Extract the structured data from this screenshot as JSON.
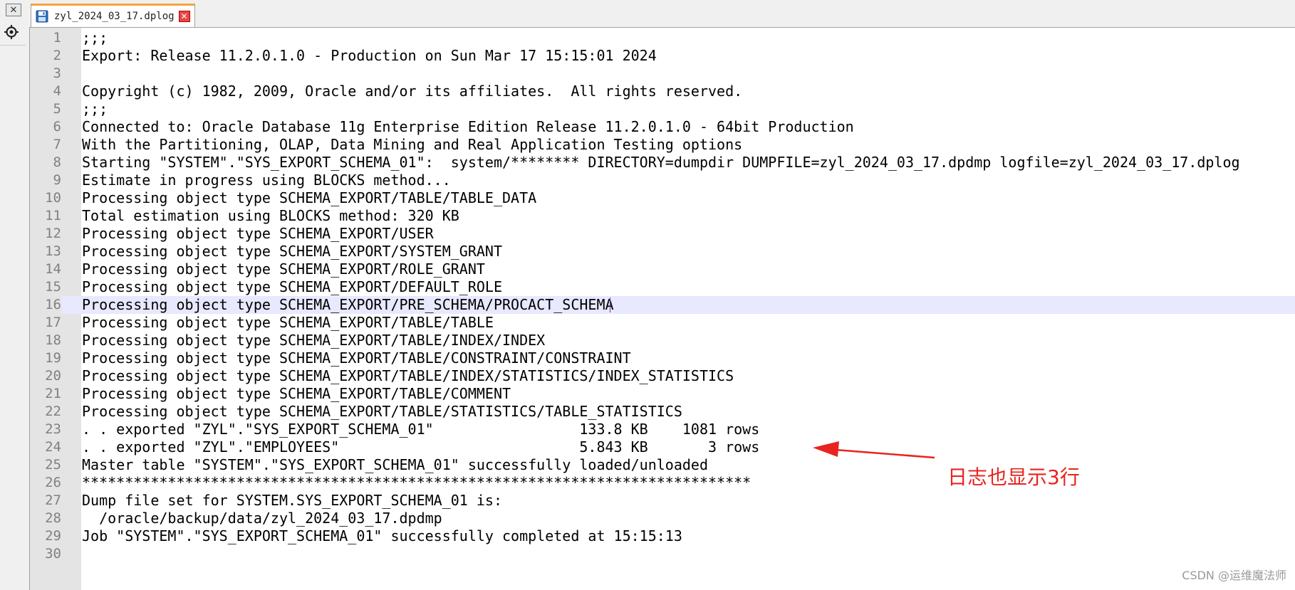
{
  "window": {
    "close_glyph": "✕"
  },
  "tab": {
    "file_icon": "save-disk-icon",
    "label": "zyl_2024_03_17.dplog",
    "close_glyph": "✕"
  },
  "toolbar": {
    "locate_icon": "target-icon"
  },
  "editor": {
    "current_line": 16,
    "lines": [
      {
        "n": "1",
        "text": ";;;"
      },
      {
        "n": "2",
        "text": "Export: Release 11.2.0.1.0 - Production on Sun Mar 17 15:15:01 2024"
      },
      {
        "n": "3",
        "text": ""
      },
      {
        "n": "4",
        "text": "Copyright (c) 1982, 2009, Oracle and/or its affiliates.  All rights reserved."
      },
      {
        "n": "5",
        "text": ";;;"
      },
      {
        "n": "6",
        "text": "Connected to: Oracle Database 11g Enterprise Edition Release 11.2.0.1.0 - 64bit Production"
      },
      {
        "n": "7",
        "text": "With the Partitioning, OLAP, Data Mining and Real Application Testing options"
      },
      {
        "n": "8",
        "text": "Starting \"SYSTEM\".\"SYS_EXPORT_SCHEMA_01\":  system/******** DIRECTORY=dumpdir DUMPFILE=zyl_2024_03_17.dpdmp logfile=zyl_2024_03_17.dplog"
      },
      {
        "n": "9",
        "text": "Estimate in progress using BLOCKS method..."
      },
      {
        "n": "10",
        "text": "Processing object type SCHEMA_EXPORT/TABLE/TABLE_DATA"
      },
      {
        "n": "11",
        "text": "Total estimation using BLOCKS method: 320 KB"
      },
      {
        "n": "12",
        "text": "Processing object type SCHEMA_EXPORT/USER"
      },
      {
        "n": "13",
        "text": "Processing object type SCHEMA_EXPORT/SYSTEM_GRANT"
      },
      {
        "n": "14",
        "text": "Processing object type SCHEMA_EXPORT/ROLE_GRANT"
      },
      {
        "n": "15",
        "text": "Processing object type SCHEMA_EXPORT/DEFAULT_ROLE"
      },
      {
        "n": "16",
        "text": "Processing object type SCHEMA_EXPORT/PRE_SCHEMA/PROCACT_SCHEMA"
      },
      {
        "n": "17",
        "text": "Processing object type SCHEMA_EXPORT/TABLE/TABLE"
      },
      {
        "n": "18",
        "text": "Processing object type SCHEMA_EXPORT/TABLE/INDEX/INDEX"
      },
      {
        "n": "19",
        "text": "Processing object type SCHEMA_EXPORT/TABLE/CONSTRAINT/CONSTRAINT"
      },
      {
        "n": "20",
        "text": "Processing object type SCHEMA_EXPORT/TABLE/INDEX/STATISTICS/INDEX_STATISTICS"
      },
      {
        "n": "21",
        "text": "Processing object type SCHEMA_EXPORT/TABLE/COMMENT"
      },
      {
        "n": "22",
        "text": "Processing object type SCHEMA_EXPORT/TABLE/STATISTICS/TABLE_STATISTICS"
      },
      {
        "n": "23",
        "text": ". . exported \"ZYL\".\"SYS_EXPORT_SCHEMA_01\"                 133.8 KB    1081 rows"
      },
      {
        "n": "24",
        "text": ". . exported \"ZYL\".\"EMPLOYEES\"                            5.843 KB       3 rows"
      },
      {
        "n": "25",
        "text": "Master table \"SYSTEM\".\"SYS_EXPORT_SCHEMA_01\" successfully loaded/unloaded"
      },
      {
        "n": "26",
        "text": "******************************************************************************"
      },
      {
        "n": "27",
        "text": "Dump file set for SYSTEM.SYS_EXPORT_SCHEMA_01 is:"
      },
      {
        "n": "28",
        "text": "  /oracle/backup/data/zyl_2024_03_17.dpdmp"
      },
      {
        "n": "29",
        "text": "Job \"SYSTEM\".\"SYS_EXPORT_SCHEMA_01\" successfully completed at 15:15:13"
      },
      {
        "n": "30",
        "text": ""
      }
    ]
  },
  "annotation": {
    "text": "日志也显示3行",
    "color": "#e8241f"
  },
  "watermark": {
    "text": "CSDN @运维魔法师"
  },
  "colors": {
    "tab_accent": "#f5a33c",
    "current_line_bg": "#e8e8ff",
    "gutter_bg": "#e4e4e4"
  }
}
